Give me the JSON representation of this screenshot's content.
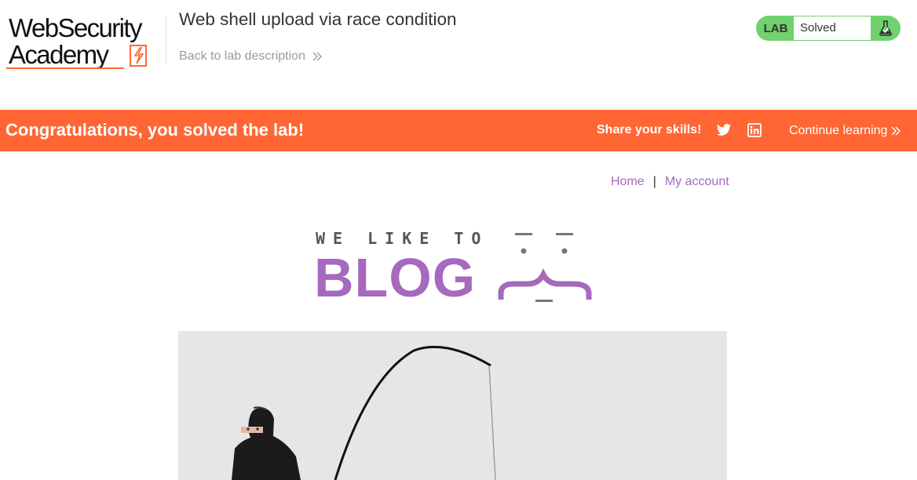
{
  "header": {
    "logo_line1": "WebSecurity",
    "logo_line2": "Academy",
    "lab_title": "Web shell upload via race condition",
    "back_link": "Back to lab description",
    "status": {
      "lab_label": "LAB",
      "state": "Solved"
    }
  },
  "banner": {
    "message": "Congratulations, you solved the lab!",
    "share_label": "Share your skills!",
    "continue_label": "Continue learning"
  },
  "nav": {
    "home": "Home",
    "separator": "|",
    "my_account": "My account"
  },
  "blog_logo": {
    "top_text": "WE LIKE TO",
    "main_text": "BLOG"
  },
  "colors": {
    "accent_orange": "#ff6633",
    "solved_green": "#70d16d",
    "link_purple": "#a569bd"
  },
  "icons": [
    "lightning-logo-icon",
    "chevron-right-icon",
    "flask-icon",
    "twitter-icon",
    "linkedin-icon",
    "double-chevron-icon"
  ]
}
